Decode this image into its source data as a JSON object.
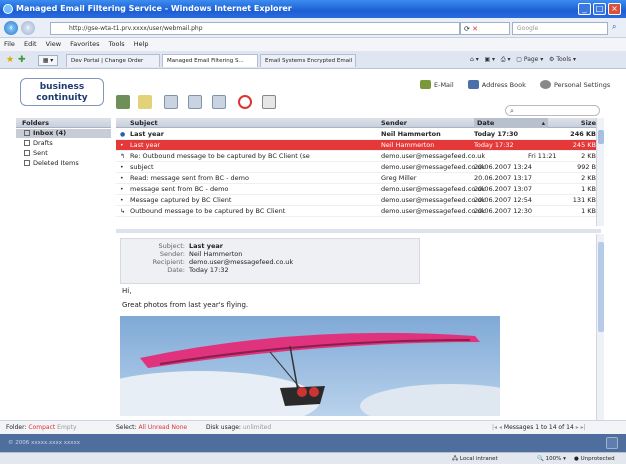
{
  "window": {
    "title": "Managed Email Filtering Service - Windows Internet Explorer",
    "url": "http://gse-wta-t1.prv.xxxx/user/webmail.php",
    "search_placeholder": "Google"
  },
  "menu": [
    "File",
    "Edit",
    "View",
    "Favorites",
    "Tools",
    "Help"
  ],
  "tabs": [
    {
      "label": "Dev Portal | Change Order",
      "active": false
    },
    {
      "label": "Managed Email Filtering S...",
      "active": true
    },
    {
      "label": "Email Systems Encrypted Email",
      "active": false
    }
  ],
  "ie_tools": {
    "page": "Page",
    "tools": "Tools"
  },
  "app": {
    "logo_line1": "business",
    "logo_line2": "continuity",
    "links": {
      "email": "E-Mail",
      "address_book": "Address Book",
      "settings": "Personal Settings"
    },
    "search_value": "",
    "folders_header": "Folders",
    "folders": [
      {
        "label": "Inbox (4)",
        "selected": true
      },
      {
        "label": "Drafts",
        "selected": false
      },
      {
        "label": "Sent",
        "selected": false
      },
      {
        "label": "Deleted Items",
        "selected": false
      }
    ],
    "columns": {
      "subject": "Subject",
      "sender": "Sender",
      "date": "Date",
      "size": "Size"
    },
    "messages": [
      {
        "subject": "Last year",
        "sender": "Neil Hammerton",
        "date": "Today 17:30",
        "size": "246 KB",
        "unread": true,
        "selected": false
      },
      {
        "subject": "Last year",
        "sender": "Neil Hammerton",
        "date": "Today 17:32",
        "size": "245 KB",
        "unread": false,
        "selected": true
      },
      {
        "subject": "Re: Outbound message to be captured by BC Client (se",
        "sender": "demo.user@messagefeed.co.uk",
        "date": "Fri 11:21",
        "size": "2 KB",
        "unread": false,
        "selected": false
      },
      {
        "subject": "subject",
        "sender": "demo.user@messagefeed.co.uk",
        "date": "20.06.2007 13:24",
        "size": "992 B",
        "unread": false,
        "selected": false
      },
      {
        "subject": "Read: message sent from BC - demo",
        "sender": "Greg Miller",
        "date": "20.06.2007 13:17",
        "size": "2 KB",
        "unread": false,
        "selected": false
      },
      {
        "subject": "message sent from BC - demo",
        "sender": "demo.user@messagefeed.co.uk",
        "date": "20.06.2007 13:07",
        "size": "1 KB",
        "unread": false,
        "selected": false
      },
      {
        "subject": "Message captured by BC Client",
        "sender": "demo.user@messagefeed.co.uk",
        "date": "20.06.2007 12:54",
        "size": "131 KB",
        "unread": false,
        "selected": false
      },
      {
        "subject": "Outbound message to be captured by BC Client",
        "sender": "demo.user@messagefeed.co.uk",
        "date": "20.06.2007 12:30",
        "size": "1 KB",
        "unread": false,
        "selected": false
      }
    ],
    "preview": {
      "subject_label": "Subject:",
      "subject": "Last year",
      "sender_label": "Sender:",
      "sender": "Neil Hammerton",
      "recipient_label": "Recipient:",
      "recipient": "demo.user@messagefeed.co.uk",
      "date_label": "Date:",
      "date": "Today 17:32",
      "body_line1": "Hi,",
      "body_line2": "Great photos from last year's flying."
    },
    "footer": {
      "folder_label": "Folder:",
      "compact": "Compact",
      "empty": "Empty",
      "select_label": "Select:",
      "all": "All",
      "unread": "Unread",
      "none": "None",
      "disk_label": "Disk usage:",
      "disk_value": "unlimited",
      "paging": "Messages 1 to 14 of 14"
    },
    "status": "© 2006 xxxxx.xxxx xxxxx"
  },
  "ie_status": {
    "zone": "Local intranet",
    "zoom": "100%",
    "protected": "Unprotected"
  },
  "colors": {
    "selected_row": "#e53838",
    "titlebar": "#1d5fd3",
    "logo_text": "#1f3a70"
  }
}
